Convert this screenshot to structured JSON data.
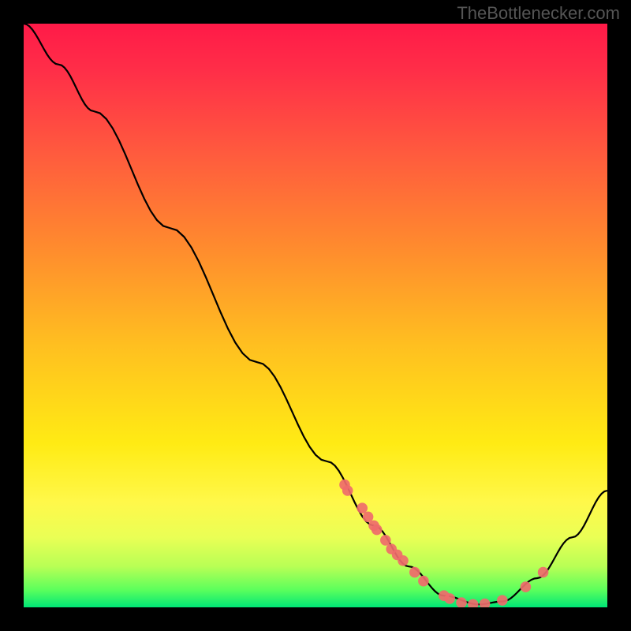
{
  "watermark": "TheBottlenecker.com",
  "chart_data": {
    "type": "line",
    "title": "",
    "xlabel": "",
    "ylabel": "",
    "xlim": [
      0,
      100
    ],
    "ylim": [
      0,
      100
    ],
    "curve": [
      {
        "x": 0,
        "y": 100
      },
      {
        "x": 6,
        "y": 93
      },
      {
        "x": 12,
        "y": 85
      },
      {
        "x": 25,
        "y": 65
      },
      {
        "x": 40,
        "y": 42
      },
      {
        "x": 52,
        "y": 25
      },
      {
        "x": 60,
        "y": 14
      },
      {
        "x": 66,
        "y": 7
      },
      {
        "x": 72,
        "y": 2
      },
      {
        "x": 78,
        "y": 0.5
      },
      {
        "x": 82,
        "y": 1
      },
      {
        "x": 88,
        "y": 5
      },
      {
        "x": 94,
        "y": 12
      },
      {
        "x": 100,
        "y": 20
      }
    ],
    "highlight_points": [
      {
        "x": 55,
        "y": 21
      },
      {
        "x": 55.5,
        "y": 20
      },
      {
        "x": 58,
        "y": 17
      },
      {
        "x": 59,
        "y": 15.5
      },
      {
        "x": 60,
        "y": 14
      },
      {
        "x": 60.5,
        "y": 13.3
      },
      {
        "x": 62,
        "y": 11.5
      },
      {
        "x": 63,
        "y": 10
      },
      {
        "x": 64,
        "y": 9
      },
      {
        "x": 65,
        "y": 8
      },
      {
        "x": 67,
        "y": 6
      },
      {
        "x": 68.5,
        "y": 4.5
      },
      {
        "x": 72,
        "y": 2
      },
      {
        "x": 73,
        "y": 1.5
      },
      {
        "x": 75,
        "y": 0.8
      },
      {
        "x": 77,
        "y": 0.5
      },
      {
        "x": 79,
        "y": 0.6
      },
      {
        "x": 82,
        "y": 1.2
      },
      {
        "x": 86,
        "y": 3.5
      },
      {
        "x": 89,
        "y": 6
      }
    ],
    "gradient_colors": {
      "top": "#ff1a48",
      "mid_upper": "#ff8a2e",
      "mid": "#ffeb14",
      "mid_lower": "#b8ff55",
      "bottom": "#00e676"
    }
  }
}
